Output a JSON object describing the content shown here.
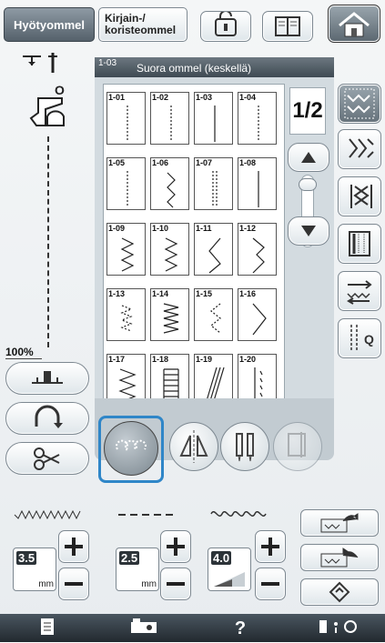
{
  "header": {
    "tab_utility": "Hyötyommel",
    "tab_character": "Kirjain-/\nkoristeommel"
  },
  "selection": {
    "id": "1-03",
    "title": "Suora ommel (keskellä)"
  },
  "left": {
    "zoom": "100%"
  },
  "stitches": [
    "1-01",
    "1-02",
    "1-03",
    "1-04",
    "1-05",
    "1-06",
    "1-07",
    "1-08",
    "1-09",
    "1-10",
    "1-11",
    "1-12",
    "1-13",
    "1-14",
    "1-15",
    "1-16",
    "1-17",
    "1-18",
    "1-19",
    "1-20"
  ],
  "page_indicator": "1/2",
  "settings": {
    "width_value": "3.5",
    "width_unit": "mm",
    "length_value": "2.5",
    "length_unit": "mm",
    "tension_value": "4.0"
  },
  "right": {
    "q_label": "Q"
  },
  "bottom": {
    "help": "?"
  },
  "colors": {
    "accent": "#2f86c8",
    "panel": "#d3dbe0"
  }
}
